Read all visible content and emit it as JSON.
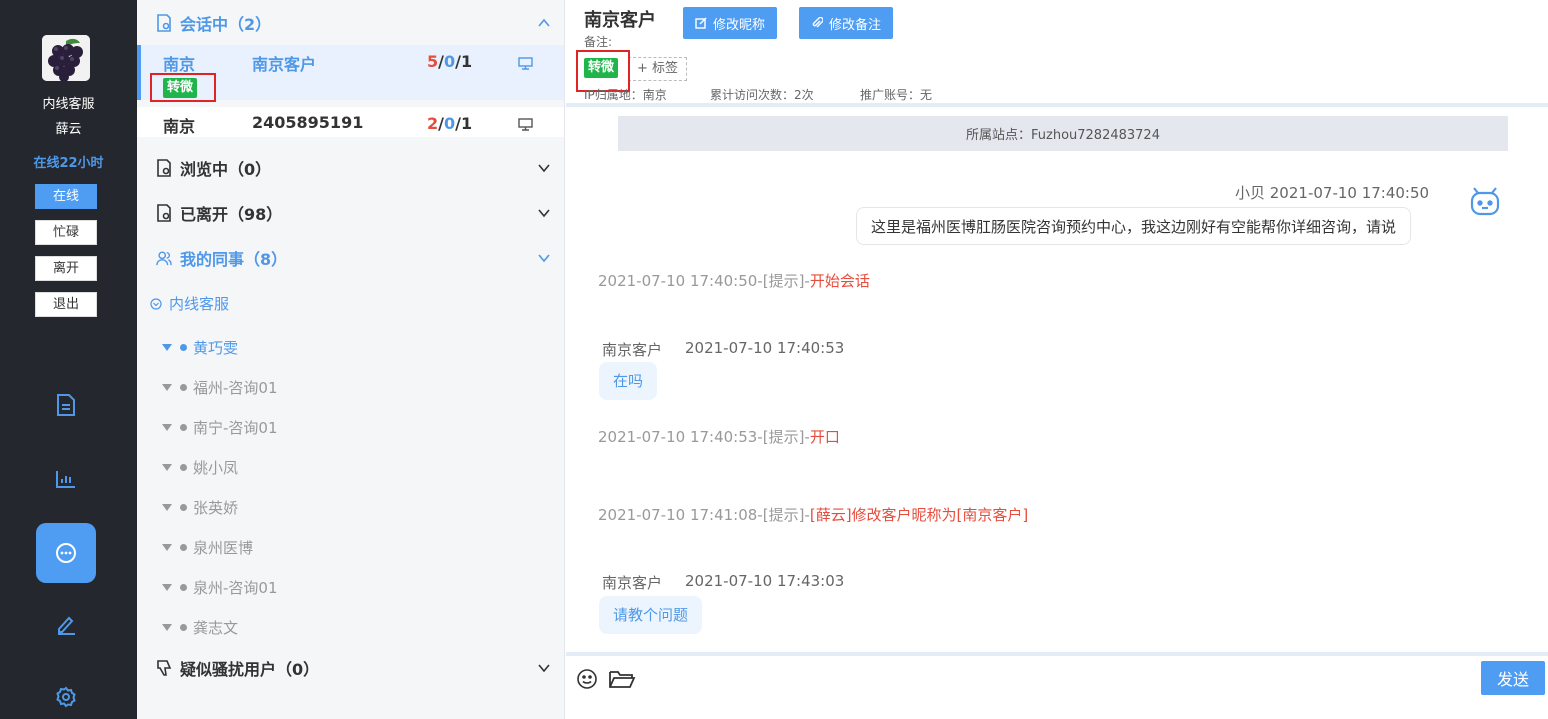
{
  "sidebar": {
    "agent_group": "内线客服",
    "agent_name": "薛云",
    "online_time": "在线22小时",
    "status_buttons": [
      "在线",
      "忙碌",
      "离开",
      "退出"
    ],
    "active_status": "在线",
    "nav_icons": [
      "document-icon",
      "chart-icon",
      "chat-icon",
      "edit-icon",
      "settings-icon"
    ],
    "active_nav": "chat-icon"
  },
  "session_list": {
    "sections": {
      "chatting": "会话中（2）",
      "browsing": "浏览中（0）",
      "left": "已离开（98）",
      "colleagues": "我的同事（8）",
      "harass": "疑似骚扰用户（0）"
    },
    "sessions": [
      {
        "city": "南京",
        "name": "南京客户",
        "count_red": "5",
        "count_blue": "0",
        "count_total": "1",
        "tag": "转微"
      },
      {
        "city": "南京",
        "name": "2405895191",
        "count_red": "2",
        "count_blue": "0",
        "count_total": "1"
      }
    ],
    "colleague_group": "内线客服",
    "colleagues": [
      "黄巧雯",
      "福州-咨询01",
      "南宁-咨询01",
      "姚小凤",
      "张英娇",
      "泉州医博",
      "泉州-咨询01",
      "龚志文"
    ]
  },
  "chat": {
    "customer_title": "南京客户",
    "edit_nickname": "修改昵称",
    "edit_remark": "修改备注",
    "remark_label": "备注:",
    "tag": "转微",
    "add_tag": "+ 标签",
    "ip_location": "IP归属地：南京",
    "visit_count": "累计访问次数：2次",
    "promo_account": "推广账号：无",
    "site": "所属站点：Fuzhou7282483724",
    "messages": {
      "m1_meta": "小贝 2021-07-10 17:40:50",
      "m1_text": "这里是福州医博肛肠医院咨询预约中心，我这边刚好有空能帮你详细咨询，请说",
      "s1_prefix": "2021-07-10 17:40:50-[提示]-",
      "s1_text": "开始会话",
      "m2_sender": "南京客户",
      "m2_time": "2021-07-10 17:40:53",
      "m2_text": "在吗",
      "s2_prefix": "2021-07-10 17:40:53-[提示]-",
      "s2_text": "开口",
      "s3_prefix": "2021-07-10 17:41:08-[提示]-",
      "s3_text": "[薛云]修改客户昵称为[南京客户]",
      "m3_sender": "南京客户",
      "m3_time": "2021-07-10 17:43:03",
      "m3_text": "请教个问题"
    },
    "send_label": "发送"
  },
  "colors": {
    "accent": "#4f9df2",
    "sidebar_bg": "#24282e",
    "tag_green": "#1fb54a",
    "alert_red": "#e74c3c"
  }
}
